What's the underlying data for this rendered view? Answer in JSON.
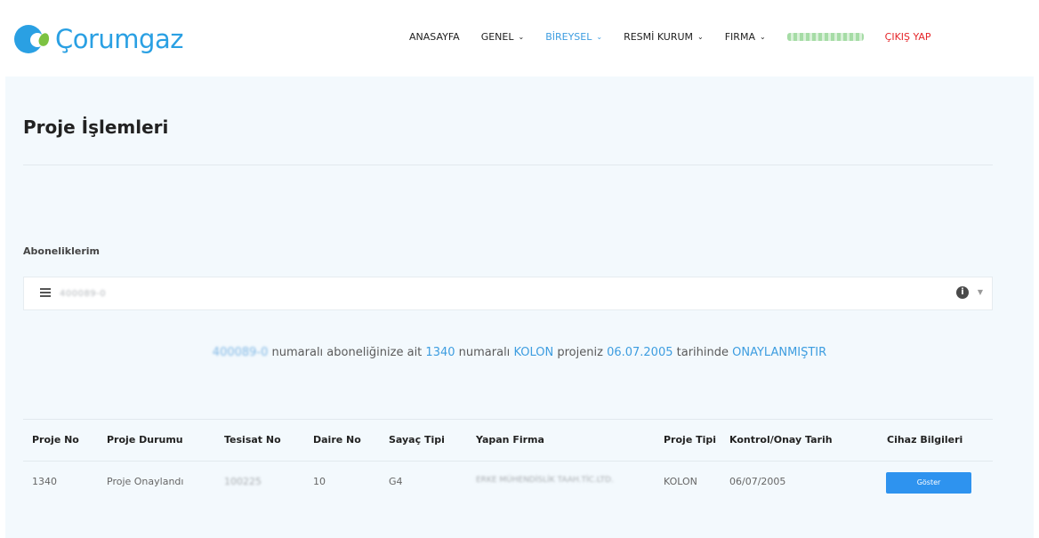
{
  "header": {
    "logo_text": "Çorumgaz",
    "nav": [
      {
        "label": "ANASAYFA",
        "dropdown": false,
        "active": false
      },
      {
        "label": "GENEL",
        "dropdown": true,
        "active": false
      },
      {
        "label": "BİREYSEL",
        "dropdown": true,
        "active": true
      },
      {
        "label": "RESMİ KURUM",
        "dropdown": true,
        "active": false
      },
      {
        "label": "FIRMA",
        "dropdown": true,
        "active": false
      }
    ],
    "user_name": "████████",
    "logout_label": "ÇIKIŞ YAP"
  },
  "page": {
    "title": "Proje İşlemleri",
    "section_label": "Aboneliklerim",
    "subscription_value": "400089-0",
    "message": {
      "subscription": "400089-0",
      "part1": " numaralı aboneliğinize ait ",
      "project_no": "1340",
      "part2": " numaralı ",
      "project_type": "KOLON",
      "part3": " projeniz ",
      "date": "06.07.2005",
      "part4": " tarihinde ",
      "status": "ONAYLANMIŞTIR"
    }
  },
  "table": {
    "headers": [
      "Proje No",
      "Proje Durumu",
      "Tesisat No",
      "Daire No",
      "Sayaç Tipi",
      "Yapan Firma",
      "Proje Tipi",
      "Kontrol/Onay Tarih",
      "Cihaz Bilgileri"
    ],
    "rows": [
      {
        "proje_no": "1340",
        "proje_durumu": "Proje Onaylandı",
        "tesisat_no": "100225",
        "daire_no": "10",
        "sayac_tipi": "G4",
        "yapan_firma": "ERKE MÜHENDİSLİK TAAH.TİC.LTD.",
        "proje_tipi": "KOLON",
        "tarih": "06/07/2005",
        "button_label": "Göster"
      }
    ]
  },
  "colors": {
    "brand": "#2aa0e3",
    "accent": "#3d9de0",
    "logout": "#e5262a",
    "button": "#2e93ef",
    "content_bg": "#f3f9fd"
  }
}
